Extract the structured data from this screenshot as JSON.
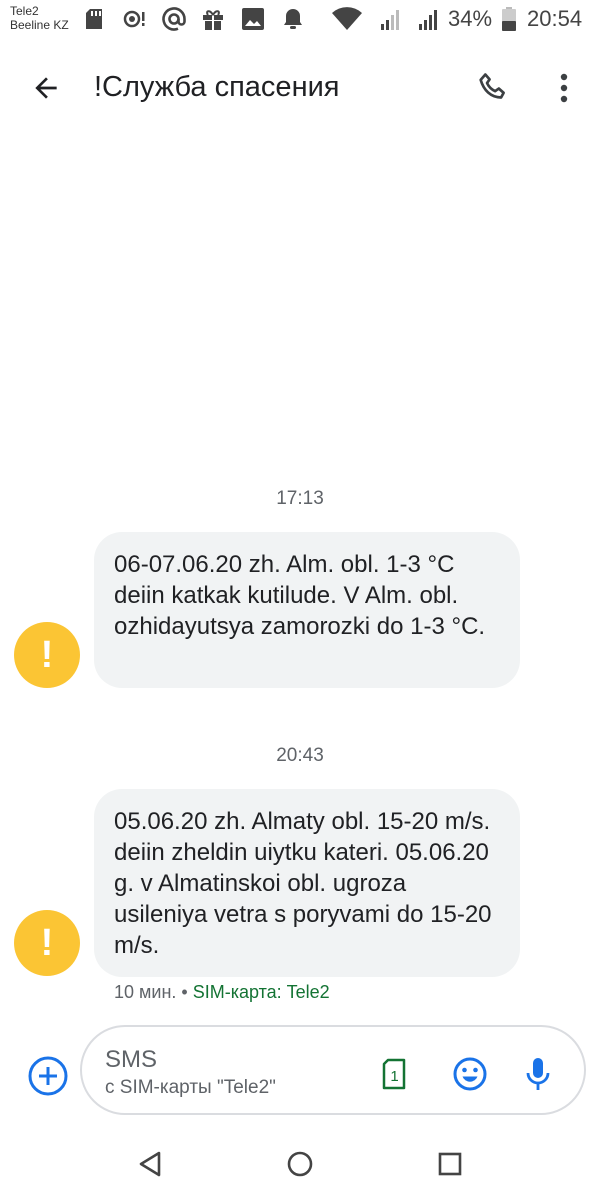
{
  "status_bar": {
    "carrier_1": "Tele2",
    "carrier_2": "Beeline KZ",
    "battery": "34%",
    "time": "20:54"
  },
  "app_bar": {
    "title": "!Служба спасения",
    "icons": [
      "back-arrow-icon",
      "phone-icon",
      "more-vert-icon"
    ]
  },
  "messages": [
    {
      "time": "17:13",
      "text": "06-07.06.20 zh. Alm. obl. 1-3 °C deiin katkak kutilude. V Alm. obl. ozhidayutsya zamorozki do 1-3 °C."
    },
    {
      "time": "20:43",
      "text": "05.06.20 zh. Almaty obl. 15-20 m/s. deiin zheldin uiytku kateri. 05.06.20 g. v Almatinskoi obl. ugroza usileniya vetra s poryvami do 15-20 m/s."
    }
  ],
  "avatar_symbol": "!",
  "last_meta": {
    "age": "10 мин. •",
    "sim": "SIM-карта: Tele2"
  },
  "composer": {
    "placeholder": "SMS",
    "sim_hint": "с SIM-карты \"Tele2\"",
    "sim_number": "1"
  },
  "colors": {
    "accent": "#1a73e8",
    "avatar": "#fbc534",
    "bubble": "#f1f3f4",
    "sim_green": "#137333"
  }
}
